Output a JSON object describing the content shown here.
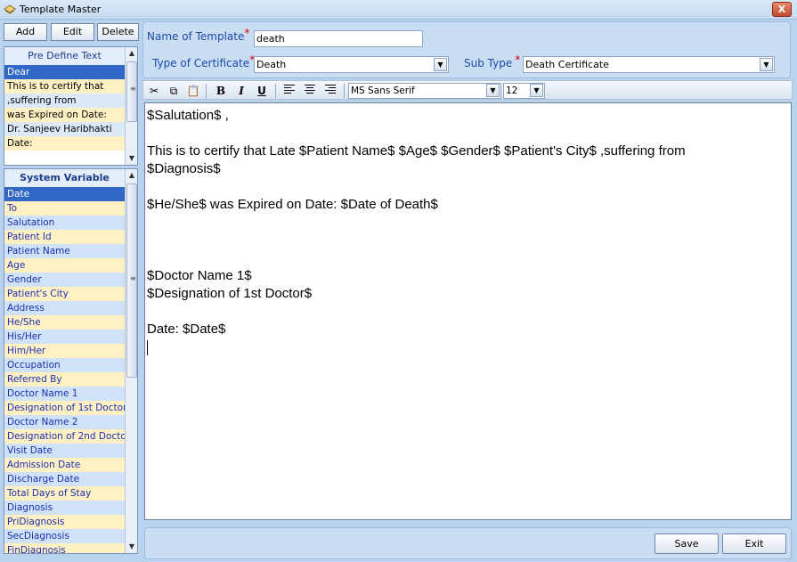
{
  "window": {
    "title": "Template Master",
    "close_label": "X"
  },
  "left_buttons": {
    "add": "Add",
    "edit": "Edit",
    "delete": "Delete"
  },
  "predefine": {
    "header": "Pre Define Text",
    "items": [
      "Dear",
      "This is to certify that",
      ",suffering from",
      "was Expired on Date:",
      "Dr. Sanjeev Haribhakti",
      "Date:"
    ],
    "selected_index": 0
  },
  "system_variable": {
    "header": "System Variable",
    "items": [
      "Date",
      "To",
      "Salutation",
      "Patient Id",
      "Patient Name",
      "Age",
      "Gender",
      "Patient's City",
      "Address",
      "He/She",
      "His/Her",
      "Him/Her",
      "Occupation",
      "Referred By",
      "Doctor Name 1",
      "Designation of 1st Doctor",
      "Doctor Name 2",
      "Designation of 2nd Doctor",
      "Visit Date",
      "Admission Date",
      "Discharge Date",
      "Total Days of Stay",
      "Diagnosis",
      "PriDiagnosis",
      "SecDiagnosis",
      "FinDiagnosis",
      "Date of Death"
    ],
    "selected_index": 0
  },
  "form": {
    "name_label": "Name of Template",
    "name_value": "death",
    "type_label": "Type of Certificate",
    "type_value": "Death",
    "subtype_label": "Sub Type",
    "subtype_value": "Death Certificate",
    "required_mark": "*"
  },
  "toolbar": {
    "font": "MS Sans Serif",
    "size": "12",
    "bold": "B",
    "italic": "I",
    "underline": "U"
  },
  "editor": {
    "lines": [
      "$Salutation$ ,",
      "",
      "This is to certify that Late $Patient Name$  $Age$  $Gender$  $Patient's City$ ,suffering from",
      "$Diagnosis$",
      "",
      "$He/She$ was Expired on Date:  $Date of Death$",
      "",
      "",
      "",
      "$Doctor Name 1$",
      "$Designation of 1st Doctor$",
      "",
      "Date: $Date$"
    ]
  },
  "bottom_buttons": {
    "save": "Save",
    "exit": "Exit"
  },
  "colors": {
    "background": "#b9d3ee",
    "selection": "#3168c7",
    "label_blue": "#1d4aa8",
    "required_red": "#d40000"
  }
}
